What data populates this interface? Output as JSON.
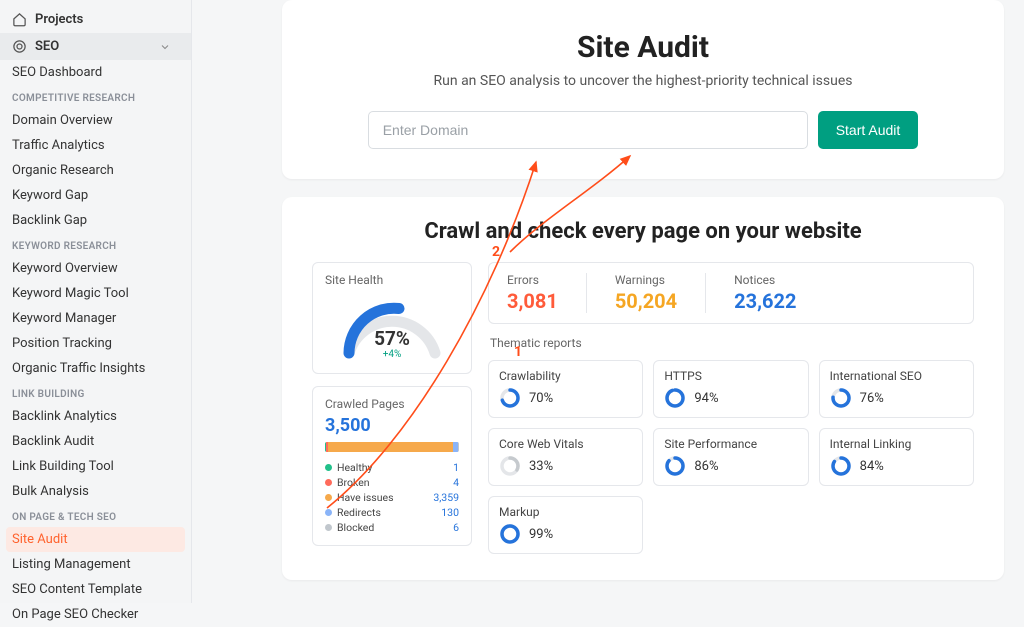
{
  "sidebar": {
    "projects": "Projects",
    "seo": "SEO",
    "dashboard": "SEO Dashboard",
    "sections": [
      {
        "title": "COMPETITIVE RESEARCH",
        "items": [
          "Domain Overview",
          "Traffic Analytics",
          "Organic Research",
          "Keyword Gap",
          "Backlink Gap"
        ]
      },
      {
        "title": "KEYWORD RESEARCH",
        "items": [
          "Keyword Overview",
          "Keyword Magic Tool",
          "Keyword Manager",
          "Position Tracking",
          "Organic Traffic Insights"
        ]
      },
      {
        "title": "LINK BUILDING",
        "items": [
          "Backlink Analytics",
          "Backlink Audit",
          "Link Building Tool",
          "Bulk Analysis"
        ]
      },
      {
        "title": "ON PAGE & TECH SEO",
        "items": [
          "Site Audit",
          "Listing Management",
          "SEO Content Template",
          "On Page SEO Checker"
        ]
      }
    ],
    "active": "Site Audit"
  },
  "hero": {
    "title": "Site Audit",
    "subtitle": "Run an SEO analysis to uncover the highest-priority technical issues",
    "placeholder": "Enter Domain",
    "button": "Start Audit"
  },
  "crawl": {
    "title": "Crawl and check every page on your website",
    "health_label": "Site Health",
    "health_value": "57%",
    "health_delta": "+4%",
    "pages_label": "Crawled Pages",
    "pages_value": "3,500",
    "legend": [
      {
        "label": "Healthy",
        "value": "1",
        "color": "#22c08a"
      },
      {
        "label": "Broken",
        "value": "4",
        "color": "#ff6b5b"
      },
      {
        "label": "Have issues",
        "value": "3,359",
        "color": "#f6a94b"
      },
      {
        "label": "Redirects",
        "value": "130",
        "color": "#8ab4f8"
      },
      {
        "label": "Blocked",
        "value": "6",
        "color": "#c1c7cd"
      }
    ],
    "stats": [
      {
        "label": "Errors",
        "value": "3,081",
        "color": "#ff5b3a"
      },
      {
        "label": "Warnings",
        "value": "50,204",
        "color": "#f5a623"
      },
      {
        "label": "Notices",
        "value": "23,622",
        "color": "#2573db"
      }
    ],
    "thematic_label": "Thematic reports",
    "tiles": [
      {
        "label": "Crawlability",
        "pct": 70,
        "low": false
      },
      {
        "label": "HTTPS",
        "pct": 94,
        "low": false
      },
      {
        "label": "International SEO",
        "pct": 76,
        "low": false
      },
      {
        "label": "Core Web Vitals",
        "pct": 33,
        "low": true
      },
      {
        "label": "Site Performance",
        "pct": 86,
        "low": false
      },
      {
        "label": "Internal Linking",
        "pct": 84,
        "low": false
      }
    ],
    "markup": {
      "label": "Markup",
      "pct": 99,
      "low": false
    }
  },
  "annotations": {
    "one": "1",
    "two": "2"
  }
}
